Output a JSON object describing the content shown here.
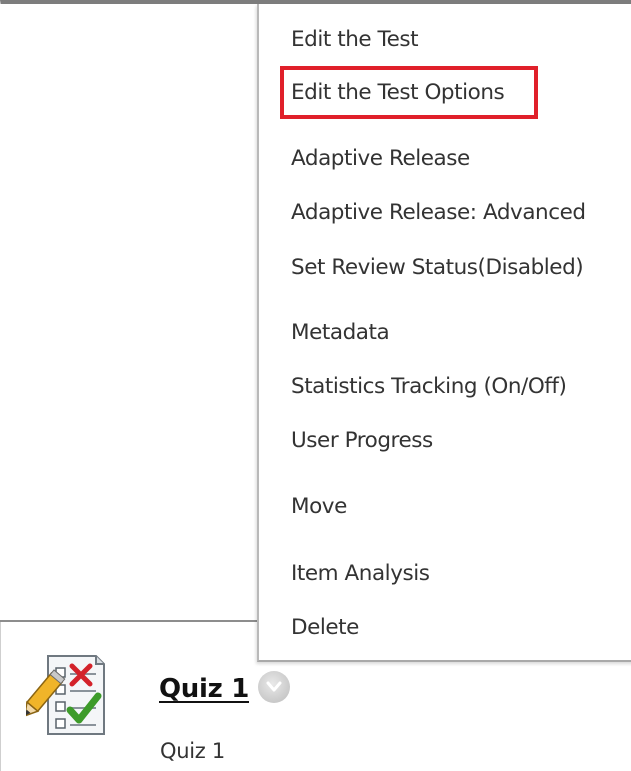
{
  "menu": {
    "items": [
      {
        "label": "Edit the Test"
      },
      {
        "label": "Edit the Test Options",
        "highlighted": true
      },
      {
        "label": "Adaptive Release"
      },
      {
        "label": "Adaptive Release: Advanced"
      },
      {
        "label": "Set Review Status(Disabled)"
      },
      {
        "label": "Metadata"
      },
      {
        "label": "Statistics Tracking (On/Off)"
      },
      {
        "label": "User Progress"
      },
      {
        "label": "Move"
      },
      {
        "label": "Item Analysis"
      },
      {
        "label": "Delete"
      }
    ],
    "highlight_color": "#e0202a"
  },
  "quiz": {
    "title": "Quiz 1",
    "description": "Quiz 1",
    "icon": "test-checklist-icon",
    "menu_button_icon": "chevron-down-icon"
  }
}
